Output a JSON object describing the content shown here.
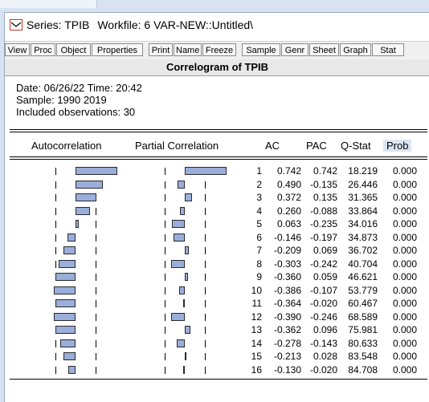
{
  "window": {
    "title_series": "Series: TPIB",
    "title_workfile": "Workfile: 6 VAR-NEW::Untitled\\"
  },
  "toolbar": {
    "buttons": [
      "View",
      "Proc",
      "Object",
      "Properties",
      "Print",
      "Name",
      "Freeze",
      "Sample",
      "Genr",
      "Sheet",
      "Graph",
      "Stat"
    ]
  },
  "view": {
    "title": "Correlogram of TPIB",
    "date_line": "Date: 06/26/22   Time: 20:42",
    "sample_line": "Sample: 1990 2019",
    "obs_line": "Included observations: 30",
    "headers": {
      "autocorrelation": "Autocorrelation",
      "partial": "Partial Correlation",
      "ac": "AC",
      "pac": "PAC",
      "qstat": "Q-Stat",
      "prob": "Prob"
    },
    "confidence_band": 0.358,
    "colors": {
      "bar_fill": "#9aaedb",
      "prob_header_bg": "#dce6f2"
    },
    "rows": [
      {
        "lag": "1",
        "ac": "0.742",
        "pac": "0.742",
        "q": "18.219",
        "prob": "0.000"
      },
      {
        "lag": "2",
        "ac": "0.490",
        "pac": "-0.135",
        "q": "26.446",
        "prob": "0.000"
      },
      {
        "lag": "3",
        "ac": "0.372",
        "pac": "0.135",
        "q": "31.365",
        "prob": "0.000"
      },
      {
        "lag": "4",
        "ac": "0.260",
        "pac": "-0.088",
        "q": "33.864",
        "prob": "0.000"
      },
      {
        "lag": "5",
        "ac": "0.063",
        "pac": "-0.235",
        "q": "34.016",
        "prob": "0.000"
      },
      {
        "lag": "6",
        "ac": "-0.146",
        "pac": "-0.197",
        "q": "34.873",
        "prob": "0.000"
      },
      {
        "lag": "7",
        "ac": "-0.209",
        "pac": "0.069",
        "q": "36.702",
        "prob": "0.000"
      },
      {
        "lag": "8",
        "ac": "-0.303",
        "pac": "-0.242",
        "q": "40.704",
        "prob": "0.000"
      },
      {
        "lag": "9",
        "ac": "-0.360",
        "pac": "0.059",
        "q": "46.621",
        "prob": "0.000"
      },
      {
        "lag": "10",
        "ac": "-0.386",
        "pac": "-0.107",
        "q": "53.779",
        "prob": "0.000"
      },
      {
        "lag": "11",
        "ac": "-0.364",
        "pac": "-0.020",
        "q": "60.467",
        "prob": "0.000"
      },
      {
        "lag": "12",
        "ac": "-0.390",
        "pac": "-0.246",
        "q": "68.589",
        "prob": "0.000"
      },
      {
        "lag": "13",
        "ac": "-0.362",
        "pac": "0.096",
        "q": "75.981",
        "prob": "0.000"
      },
      {
        "lag": "14",
        "ac": "-0.278",
        "pac": "-0.143",
        "q": "80.633",
        "prob": "0.000"
      },
      {
        "lag": "15",
        "ac": "-0.213",
        "pac": "0.028",
        "q": "83.548",
        "prob": "0.000"
      },
      {
        "lag": "16",
        "ac": "-0.130",
        "pac": "-0.020",
        "q": "84.708",
        "prob": "0.000"
      }
    ]
  }
}
